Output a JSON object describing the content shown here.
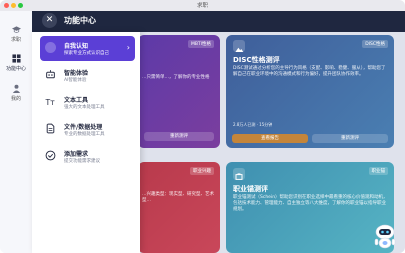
{
  "window": {
    "title": "求职"
  },
  "rail": {
    "items": [
      {
        "label": "求职",
        "icon": "hat-icon"
      },
      {
        "label": "功能中心",
        "icon": "grid-icon"
      },
      {
        "label": "我的",
        "icon": "user-icon"
      }
    ]
  },
  "header": {
    "title": "功能中心"
  },
  "drawer": {
    "items": [
      {
        "title": "自我认知",
        "desc": "探索专业方式认识自己",
        "active": true
      },
      {
        "title": "智能体验",
        "desc": "AI智能体验"
      },
      {
        "title": "文本工具",
        "desc": "强大的文本处理工具"
      },
      {
        "title": "文件/数据处理",
        "desc": "专业的数据处理工具"
      },
      {
        "title": "添加需求",
        "desc": "提交功能需求建议"
      }
    ]
  },
  "cards": [
    {
      "tag": "MBTI性格",
      "title": "",
      "desc": "…只需简单…，了解你的专业性格",
      "button": "重新测评"
    },
    {
      "tag": "DISC性格",
      "title": "DISC性格测评",
      "desc": "DISC测试通过分析您的主导行为风格（支配、影响、稳健、服从），帮助您了解自己在职业环境中的沟通模式和行为偏好，提升团队协作效率。",
      "button_primary": "查看报告",
      "button_secondary": "重新测评",
      "meta": "2.8万人已测 · 15分钟"
    },
    {
      "tag": "职业兴趣",
      "title": "",
      "desc": "…兴趣类型：现实型、研究型、艺术型…",
      "button": ""
    },
    {
      "tag": "职业锚",
      "title": "职业锚测评",
      "desc": "职业锚测试（Schein）帮助您识别在职业选择中最看重的核心价值观和动机，包括技术能力、管理能力、自主独立等八大维度，了解你的职业锚以指导职业规划。",
      "button": ""
    }
  ],
  "colors": {
    "accent": "#5b3fd6",
    "header": "#1f2740",
    "card_purple": "#6a3aa8",
    "card_blue": "#3f6ea8",
    "card_red": "#b43b4e",
    "card_teal": "#4aa0b8",
    "highlight_orange": "#d18a2c"
  }
}
